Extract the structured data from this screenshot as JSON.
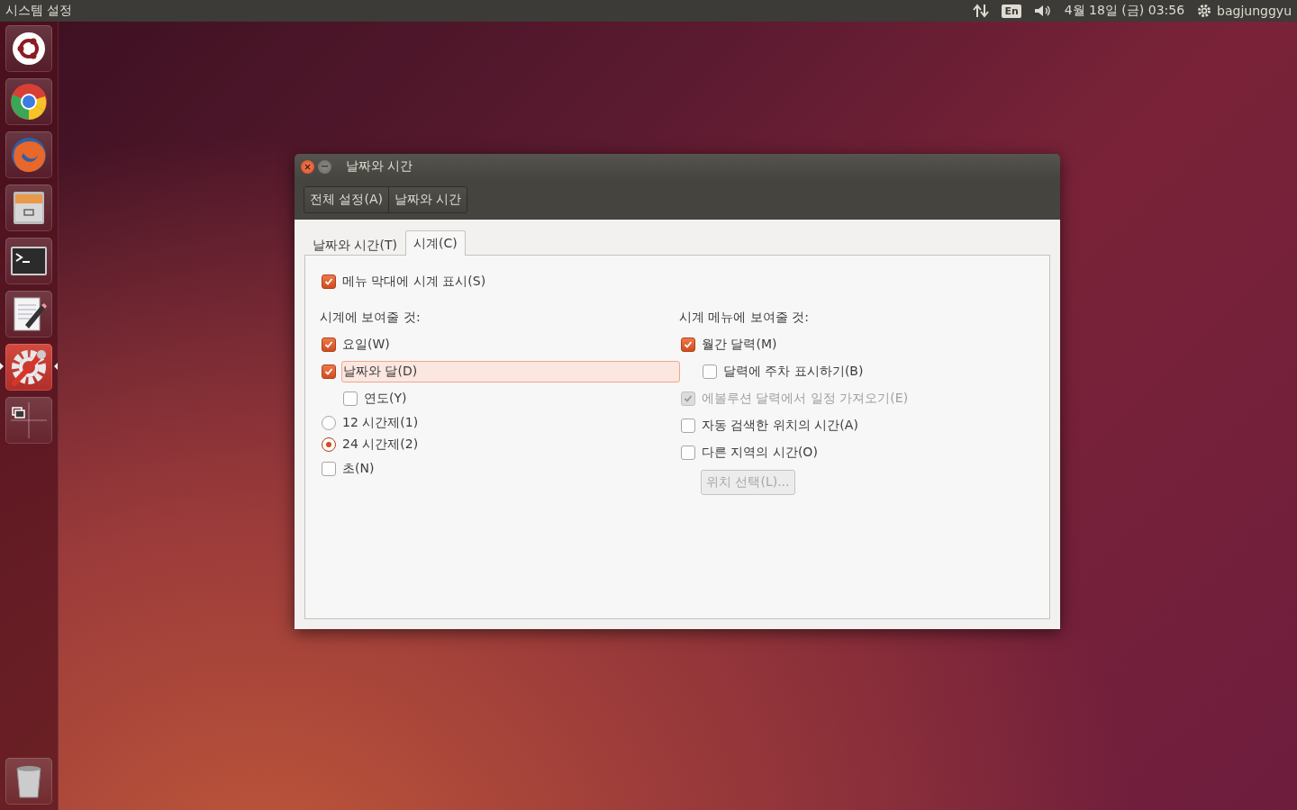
{
  "top_panel": {
    "title": "시스템 설정",
    "keyboard": "En",
    "clock": "4월 18일 (금) 03:56",
    "user": "bagjunggyu"
  },
  "launcher": [
    {
      "kind": "ubuntu",
      "active": false
    },
    {
      "kind": "browser",
      "active": false
    },
    {
      "kind": "firefox",
      "active": false
    },
    {
      "kind": "files",
      "active": false
    },
    {
      "kind": "terminal",
      "active": false
    },
    {
      "kind": "editor",
      "active": false
    },
    {
      "kind": "settings",
      "active": true
    },
    {
      "kind": "workspaces",
      "active": false
    },
    {
      "kind": "trash",
      "active": false
    }
  ],
  "window": {
    "title": "날짜와 시간",
    "breadcrumbs": [
      {
        "label": "전체 설정(A)"
      },
      {
        "label": "날짜와 시간"
      }
    ],
    "tabs": [
      {
        "label": "날짜와 시간(T)",
        "selected": false
      },
      {
        "label": "시계(C)",
        "selected": true
      }
    ],
    "show_in_menubar": {
      "label": "메뉴 막대에 시계 표시(S)",
      "checked": true
    },
    "left": {
      "heading": "시계에 보여줄 것:",
      "items": [
        {
          "kind": "checkbox",
          "label": "요일(W)",
          "checked": true,
          "focused": false,
          "disabled": false
        },
        {
          "kind": "checkbox",
          "label": "날짜와 달(D)",
          "checked": true,
          "focused": true,
          "disabled": false,
          "children": [
            {
              "kind": "checkbox",
              "label": "연도(Y)",
              "checked": false,
              "focused": false,
              "disabled": false
            }
          ]
        },
        {
          "kind": "radio",
          "label": "12 시간제(1)",
          "selected": false
        },
        {
          "kind": "radio",
          "label": "24 시간제(2)",
          "selected": true
        },
        {
          "kind": "checkbox",
          "label": "초(N)",
          "checked": false,
          "focused": false,
          "disabled": false
        }
      ]
    },
    "right": {
      "heading": "시계 메뉴에 보여줄 것:",
      "items": [
        {
          "kind": "checkbox",
          "label": "월간 달력(M)",
          "checked": true,
          "focused": false,
          "disabled": false,
          "children": [
            {
              "kind": "checkbox",
              "label": "달력에 주차 표시하기(B)",
              "checked": false,
              "focused": false,
              "disabled": false
            }
          ]
        },
        {
          "kind": "checkbox",
          "label": "에볼루션 달력에서 일정 가져오기(E)",
          "checked": true,
          "focused": false,
          "disabled": true
        },
        {
          "kind": "checkbox",
          "label": "자동 검색한 위치의 시간(A)",
          "checked": false,
          "focused": false,
          "disabled": false
        },
        {
          "kind": "checkbox",
          "label": "다른 지역의 시간(O)",
          "checked": false,
          "focused": false,
          "disabled": false
        },
        {
          "kind": "button",
          "label": "위치 선택(L)...",
          "disabled": true
        }
      ]
    }
  }
}
